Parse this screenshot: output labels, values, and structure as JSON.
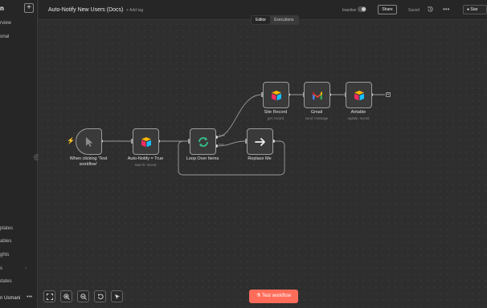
{
  "sidebar": {
    "logo": "n",
    "items": [
      {
        "label": "rview"
      },
      {
        "label": "onal"
      }
    ],
    "bottom_items": [
      {
        "label": "plates"
      },
      {
        "label": "ables"
      },
      {
        "label": "ghts"
      },
      {
        "label": "s"
      },
      {
        "label": "dates"
      }
    ],
    "user_name": "n Usmani"
  },
  "header": {
    "workflow_title": "Auto-Notify New Users (Docs)",
    "add_tag": "+ Add tag",
    "inactive_label": "Inactive",
    "share_label": "Share",
    "saved_label": "Saved",
    "star_label": "Star"
  },
  "tabs": [
    {
      "label": "Editor",
      "active": true
    },
    {
      "label": "Executions",
      "active": false
    }
  ],
  "nodes": [
    {
      "label": "When clicking 'Test workflow'",
      "subtitle": "",
      "icon": "cursor-icon"
    },
    {
      "label": "Auto-Notify = True",
      "subtitle": "search: record",
      "icon": "airtable-icon"
    },
    {
      "label": "Loop Over Items",
      "subtitle": "",
      "icon": "loop-icon"
    },
    {
      "label": "Replace Me",
      "subtitle": "",
      "icon": "arrow-right-icon"
    },
    {
      "label": "Site Record",
      "subtitle": "get: record",
      "icon": "airtable-icon"
    },
    {
      "label": "Gmail",
      "subtitle": "send: message",
      "icon": "gmail-icon"
    },
    {
      "label": "Airtable",
      "subtitle": "update: record",
      "icon": "airtable-icon"
    }
  ],
  "ports": {
    "done": "done",
    "loop": "loop"
  },
  "test_button": "Test workflow",
  "colors": {
    "accent": "#ff6d5a",
    "canvas": "#2e2e2e",
    "node_border": "#9c9c9c"
  }
}
